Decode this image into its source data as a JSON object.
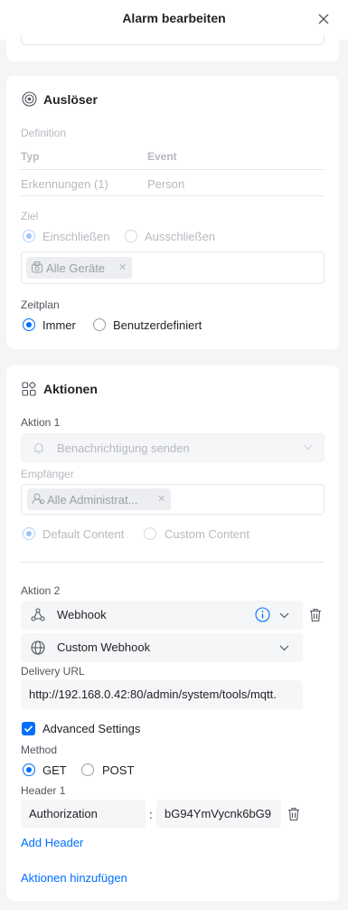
{
  "header": {
    "title": "Alarm bearbeiten"
  },
  "trigger": {
    "title": "Auslöser",
    "definition_label": "Definition",
    "col_type": "Typ",
    "col_event": "Event",
    "row_type": "Erkennungen (1)",
    "row_event": "Person",
    "target_label": "Ziel",
    "target_options": [
      "Einschließen",
      "Ausschließen"
    ],
    "target_chip": "Alle Geräte",
    "schedule_label": "Zeitplan",
    "schedule_options": [
      "Immer",
      "Benutzerdefiniert"
    ]
  },
  "actions": {
    "title": "Aktionen",
    "action1": {
      "label": "Aktion 1",
      "type": "Benachrichtigung senden",
      "recipient_label": "Empfänger",
      "recipient_chip": "Alle Administrat...",
      "content_options": [
        "Default Content",
        "Custom Content"
      ]
    },
    "action2": {
      "label": "Aktion 2",
      "type": "Webhook",
      "webhook_type": "Custom Webhook",
      "delivery_url_label": "Delivery URL",
      "delivery_url": "http://192.168.0.42:80/admin/system/tools/mqtt.",
      "advanced_settings": "Advanced Settings",
      "method_label": "Method",
      "method_options": [
        "GET",
        "POST"
      ],
      "header_label": "Header 1",
      "header_key": "Authorization",
      "header_sep": ":",
      "header_value": "bG94YmVycnk6bG9",
      "add_header": "Add Header"
    },
    "add_action": "Aktionen hinzufügen"
  },
  "colors": {
    "accent": "#006fff",
    "disabled_text": "#b6b9bf",
    "page_bg": "#f4f5f6"
  }
}
